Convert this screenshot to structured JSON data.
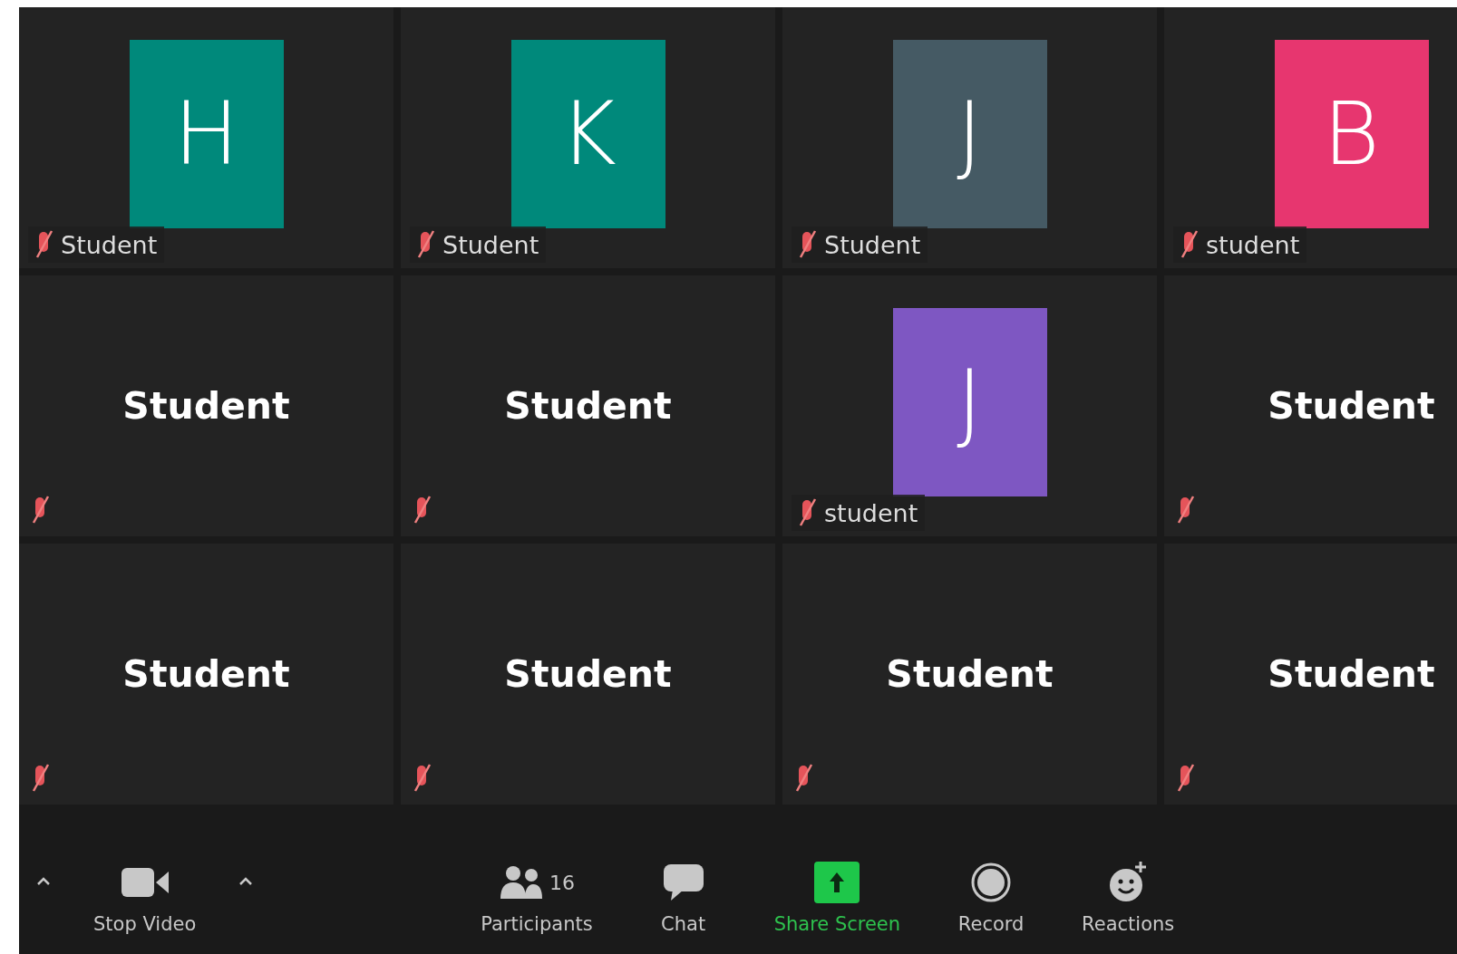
{
  "tiles": [
    {
      "kind": "avatar",
      "letter": "H",
      "color": "#00897b",
      "name": "Student",
      "muted": true
    },
    {
      "kind": "avatar",
      "letter": "K",
      "color": "#00897b",
      "name": "Student",
      "muted": true
    },
    {
      "kind": "avatar",
      "letter": "J",
      "color": "#455a64",
      "name": "Student",
      "muted": true
    },
    {
      "kind": "avatar",
      "letter": "B",
      "color": "#e7366f",
      "name": "student",
      "muted": true
    },
    {
      "kind": "name",
      "name": "Student",
      "muted": true
    },
    {
      "kind": "name",
      "name": "Student",
      "muted": true
    },
    {
      "kind": "avatar",
      "letter": "J",
      "color": "#7e57c2",
      "name": "student",
      "muted": true
    },
    {
      "kind": "name",
      "name": "Student",
      "muted": true
    },
    {
      "kind": "name",
      "name": "Student",
      "muted": true
    },
    {
      "kind": "name",
      "name": "Student",
      "muted": true
    },
    {
      "kind": "name",
      "name": "Student",
      "muted": true
    },
    {
      "kind": "name",
      "name": "Student",
      "muted": true
    }
  ],
  "toolbar": {
    "left": [
      {
        "kind": "video",
        "label": "Stop Video"
      }
    ],
    "center": [
      {
        "kind": "participants",
        "label": "Participants",
        "count": "16"
      },
      {
        "kind": "chat",
        "label": "Chat"
      },
      {
        "kind": "share",
        "label": "Share Screen"
      },
      {
        "kind": "record",
        "label": "Record"
      },
      {
        "kind": "reactions",
        "label": "Reactions"
      }
    ]
  }
}
